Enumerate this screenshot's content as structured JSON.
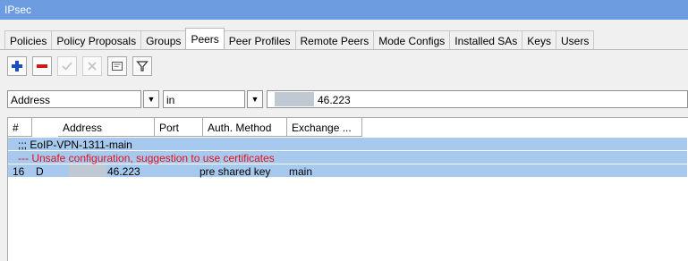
{
  "window": {
    "title": "IPsec"
  },
  "tabs": [
    {
      "label": "Policies"
    },
    {
      "label": "Policy Proposals"
    },
    {
      "label": "Groups"
    },
    {
      "label": "Peers",
      "active": true
    },
    {
      "label": "Peer Profiles"
    },
    {
      "label": "Remote Peers"
    },
    {
      "label": "Mode Configs"
    },
    {
      "label": "Installed SAs"
    },
    {
      "label": "Keys"
    },
    {
      "label": "Users"
    }
  ],
  "toolbar": {
    "buttons": [
      {
        "icon": "plus-icon",
        "enabled": true
      },
      {
        "icon": "minus-icon",
        "enabled": true
      },
      {
        "icon": "check-icon",
        "enabled": false
      },
      {
        "icon": "cross-icon",
        "enabled": false
      },
      {
        "icon": "comment-icon",
        "enabled": true
      },
      {
        "icon": "filter-icon",
        "enabled": true
      }
    ]
  },
  "filter": {
    "field": "Address",
    "operator": "in",
    "value_suffix": "46.223"
  },
  "grid": {
    "columns": [
      "#",
      "Address",
      "Port",
      "Auth. Method",
      "Exchange ..."
    ],
    "comment_row": ";;; EoIP-VPN-1311-main",
    "warning_row": "--- Unsafe configuration, suggestion to use certificates",
    "rows": [
      {
        "num": "16",
        "flag": "D",
        "address_suffix": "46.223",
        "port": "",
        "auth_method": "pre shared key",
        "exchange": "main"
      }
    ]
  },
  "colors": {
    "titlebar": "#6d9de0",
    "selected_row": "#a7c9ee",
    "warning_text": "#e0101e"
  }
}
